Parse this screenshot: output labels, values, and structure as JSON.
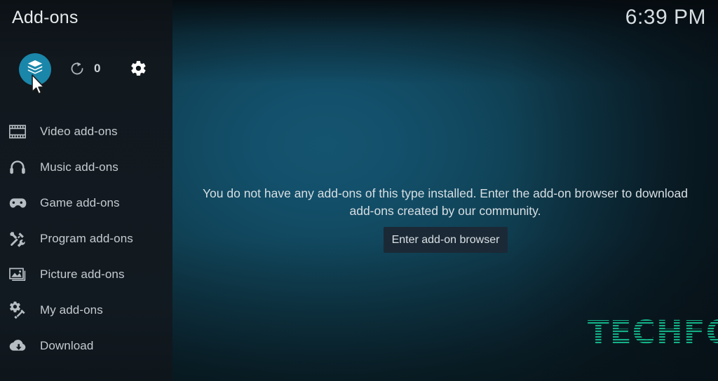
{
  "window": {
    "title": "Add-ons",
    "clock": "6:39 PM"
  },
  "colors": {
    "accent": "#1a86a9",
    "sidebar_bg": "#11181e",
    "content_bg_bright": "#15546f",
    "content_bg_dark": "#0a1c26",
    "button_bg": "#1b2936",
    "text_primary": "#d8dfe3",
    "text_secondary": "#c4ccd1",
    "watermark": "#14a37f"
  },
  "toolbar": {
    "package_icon": "package-box-icon",
    "package_label": "Add-on browser",
    "refresh_icon": "refresh-update-icon",
    "update_count": "0",
    "settings_icon": "gear-icon"
  },
  "sidebar": {
    "items": [
      {
        "label": "Video add-ons",
        "icon": "film-strip-icon"
      },
      {
        "label": "Music add-ons",
        "icon": "headphones-icon"
      },
      {
        "label": "Game add-ons",
        "icon": "gamepad-icon"
      },
      {
        "label": "Program add-ons",
        "icon": "screwdriver-wrench-icon"
      },
      {
        "label": "Picture add-ons",
        "icon": "image-photo-icon"
      },
      {
        "label": "My add-ons",
        "icon": "gear-puzzle-icon"
      },
      {
        "label": "Download",
        "icon": "cloud-download-icon"
      }
    ]
  },
  "main": {
    "empty_message": "You do not have any add-ons of this type installed. Enter the add-on browser to download add-ons created by our community.",
    "enter_browser_label": "Enter add-on browser"
  },
  "watermark": {
    "text": "TECHFOLLOWS"
  },
  "cursor": {
    "icon": "mouse-pointer-icon"
  }
}
